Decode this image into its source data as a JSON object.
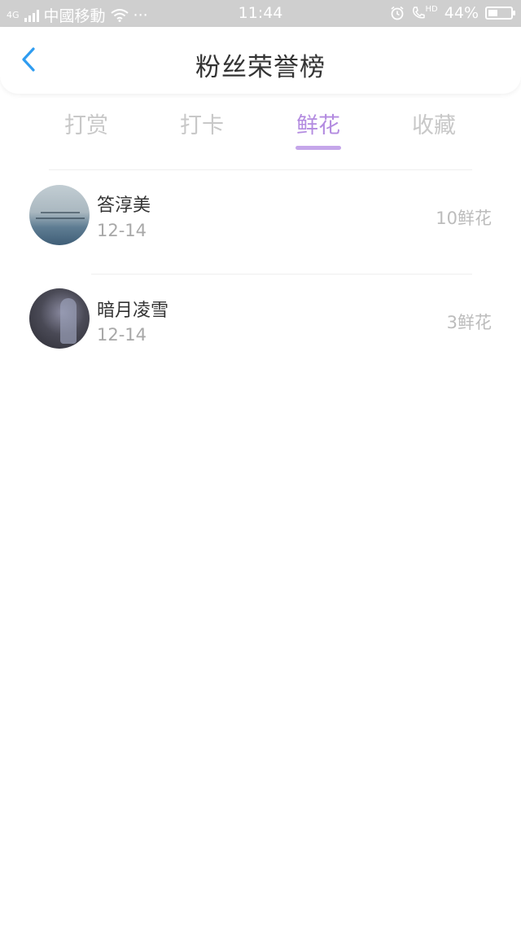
{
  "status_bar": {
    "network_badge": "4G",
    "carrier": "中國移動",
    "more_dots": "···",
    "time": "11:44",
    "volte_badge": "HD",
    "battery_percent": "44%",
    "battery_level": 0.44,
    "icons": [
      "signal-icon",
      "wifi-icon",
      "alarm-icon",
      "call-hd-icon",
      "battery-icon"
    ]
  },
  "header": {
    "title": "粉丝荣誉榜",
    "back_icon": "chevron-left-icon",
    "accent_color": "#2f9cf0"
  },
  "tabs": {
    "items": [
      {
        "label": "打赏",
        "active": false
      },
      {
        "label": "打卡",
        "active": false
      },
      {
        "label": "鲜花",
        "active": true
      },
      {
        "label": "收藏",
        "active": false
      }
    ],
    "active_color": "#b38be0",
    "inactive_color": "#c8c8c8"
  },
  "list": {
    "items": [
      {
        "name": "答淳美",
        "date": "12-14",
        "amount": "10鲜花"
      },
      {
        "name": "暗月凌雪",
        "date": "12-14",
        "amount": "3鲜花"
      }
    ]
  }
}
